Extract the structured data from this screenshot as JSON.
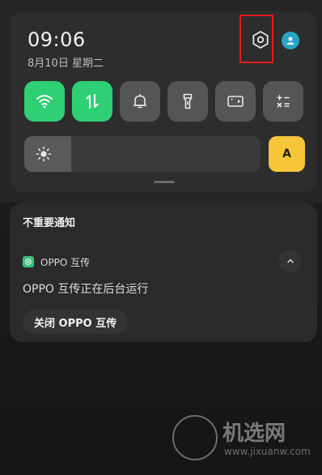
{
  "status_panel": {
    "time": "09:06",
    "date": "8月10日  星期二"
  },
  "quick_toggles": [
    {
      "name": "wifi",
      "icon": "wifi-icon",
      "state": "on"
    },
    {
      "name": "mobile-data",
      "icon": "data-arrows-icon",
      "state": "on"
    },
    {
      "name": "sound",
      "icon": "bell-icon",
      "state": "off"
    },
    {
      "name": "flashlight",
      "icon": "flashlight-icon",
      "state": "off"
    },
    {
      "name": "screen-record",
      "icon": "screen-record-icon",
      "state": "off"
    },
    {
      "name": "calculator",
      "icon": "calculator-icon",
      "state": "off"
    }
  ],
  "brightness": {
    "level": 0.2,
    "auto_label": "A"
  },
  "notifications": {
    "section_title": "不重要通知",
    "app_name": "OPPO 互传",
    "body": "OPPO 互传正在后台运行",
    "action_label": "关闭 OPPO 互传"
  },
  "watermark": {
    "title": "机选网",
    "url": "www.jixuanw.com"
  },
  "colors": {
    "toggle_on": "#2fcf74",
    "toggle_off": "#555555",
    "auto_button": "#f6c53a",
    "highlight": "#e31b1b",
    "account": "#28a6c8"
  }
}
